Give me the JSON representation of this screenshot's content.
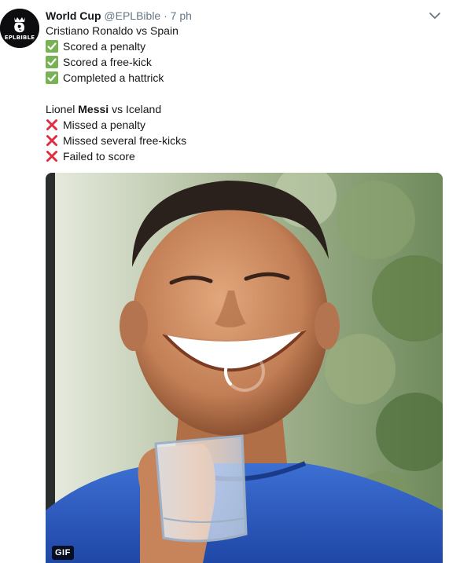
{
  "tweet": {
    "author": {
      "display_name": "World Cup",
      "handle": "@EPLBible",
      "separator": "·",
      "time": "7 ph",
      "avatar_icon": "lion-crown-icon",
      "avatar_text": "EPLBIBLE"
    },
    "menu_icon": "chevron-down-icon",
    "lines": {
      "ronaldo_intro": "Cristiano Ronaldo vs Spain",
      "ronaldo_1": "Scored a penalty",
      "ronaldo_2": "Scored a free-kick",
      "ronaldo_3": "Completed a hattrick",
      "messi_pre": "Lionel ",
      "messi_bold": "Messi",
      "messi_post": " vs Iceland",
      "messi_1": "Missed a penalty",
      "messi_2": "Missed several free-kicks",
      "messi_3": "Failed to score"
    },
    "emoji": {
      "check": "white-check-mark-icon",
      "cross": "cross-mark-icon",
      "check_color": "#77b255",
      "cross_color": "#dd2e44"
    },
    "media": {
      "badge": "GIF",
      "loading_icon": "loading-spinner-icon"
    }
  }
}
